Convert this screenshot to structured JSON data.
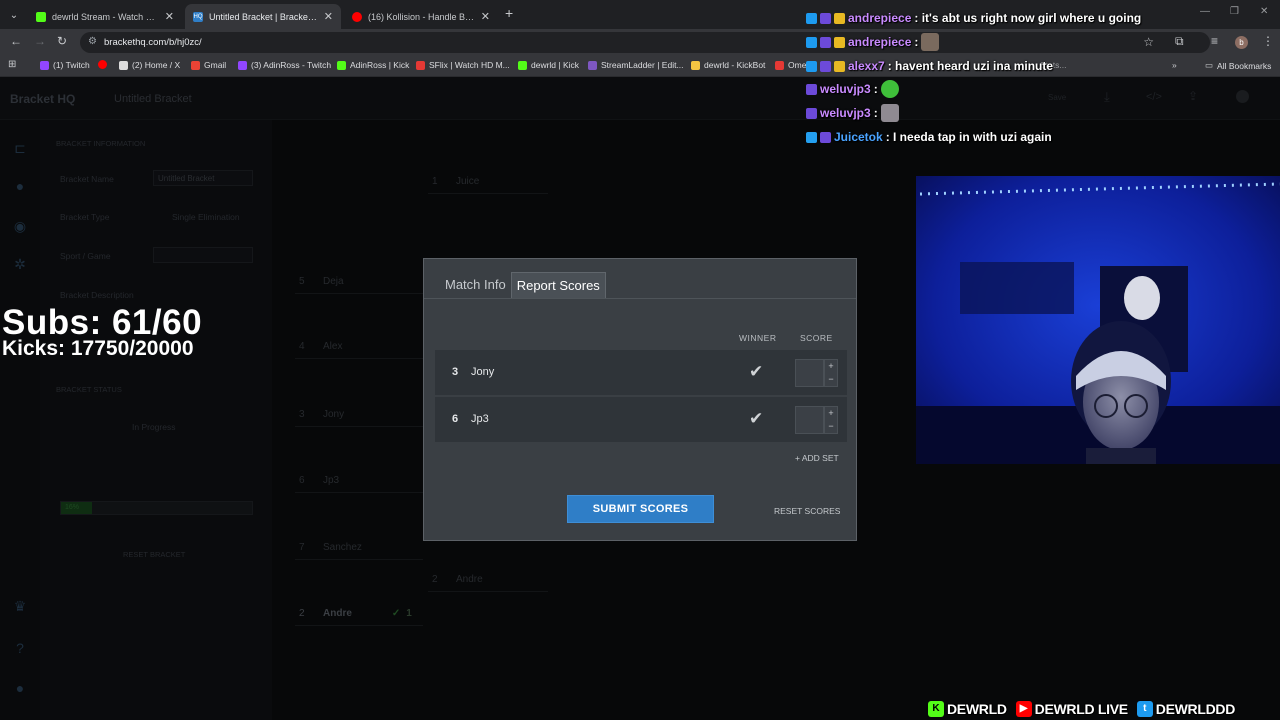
{
  "browser": {
    "tabs": [
      {
        "title": "dewrld Stream - Watch Live on Kick",
        "favicon_color": "#53fc18"
      },
      {
        "title": "Untitled Bracket | Bracket HQ",
        "favicon_color": "#2f7ec7",
        "active": true
      },
      {
        "title": "(16) Kollision - Handle Business",
        "favicon_color": "#ff0000"
      }
    ],
    "url": "brackethq.com/b/hj0zc/",
    "bookmarks": [
      {
        "label": "(1) Twitch",
        "color": "#9146ff"
      },
      {
        "label": "",
        "color": "#ff0000"
      },
      {
        "label": "(2) Home / X",
        "color": "#dddddd"
      },
      {
        "label": "Gmail",
        "color": "#ea4335"
      },
      {
        "label": "(3) AdinRoss - Twitch",
        "color": "#9146ff"
      },
      {
        "label": "AdinRoss | Kick",
        "color": "#53fc18"
      },
      {
        "label": "SFlix | Watch HD M...",
        "color": "#e53935"
      },
      {
        "label": "dewrld | Kick",
        "color": "#53fc18"
      },
      {
        "label": "StreamLadder | Edit...",
        "color": "#7e57c2"
      },
      {
        "label": "dewrld - KickBot",
        "color": "#f5c542"
      },
      {
        "label": "Ome",
        "color": "#e53935"
      }
    ],
    "bookmarks_overflow": "Stats...",
    "all_bookmarks": "All Bookmarks"
  },
  "bracket_page": {
    "brand": "Bracket HQ",
    "title": "Untitled Bracket",
    "save_label": "Save",
    "side_panel": {
      "section_info": "BRACKET INFORMATION",
      "name_label": "Bracket Name",
      "name_value": "Untitled Bracket",
      "type_label": "Bracket Type",
      "type_value": "Single Elimination",
      "sport_label": "Sport / Game",
      "description_label": "Bracket Description",
      "section_status": "BRACKET STATUS",
      "status_value": "In Progress",
      "progress_label": "16%",
      "progress_fraction": 0.16,
      "reset_label": "RESET BRACKET"
    },
    "seeds": [
      {
        "seed": "1",
        "name": "Juice"
      },
      {
        "seed": "5",
        "name": "Deja"
      },
      {
        "seed": "4",
        "name": "Alex"
      },
      {
        "seed": "3",
        "name": "Jony"
      },
      {
        "seed": "6",
        "name": "Jp3"
      },
      {
        "seed": "7",
        "name": "Sanchez"
      },
      {
        "seed": "2",
        "name": "Andre"
      },
      {
        "seed": "2",
        "name": "Andre",
        "score": "1"
      }
    ]
  },
  "modal": {
    "tabs": [
      "Match Info",
      "Report Scores"
    ],
    "winner_header": "WINNER",
    "score_header": "SCORE",
    "rows": [
      {
        "seed": "3",
        "name": "Jony",
        "score": ""
      },
      {
        "seed": "6",
        "name": "Jp3",
        "score": ""
      }
    ],
    "add_set": "+ ADD SET",
    "submit": "SUBMIT SCORES",
    "reset": "RESET SCORES"
  },
  "overlay": {
    "subs": "Subs: 61/60",
    "kicks": "Kicks: 17750/20000",
    "chat": [
      {
        "user": "andrepiece",
        "user_color": "#c98bff",
        "message": ": it's abt us right now girl where u going"
      },
      {
        "user": "andrepiece",
        "user_color": "#c98bff",
        "message": " :"
      },
      {
        "user": "alexx7",
        "user_color": "#c98bff",
        "message": ": havent heard uzi ina minute"
      },
      {
        "user": "weluvjp3",
        "user_color": "#c98bff",
        "message": " :"
      },
      {
        "user": "weluvjp3",
        "user_color": "#c98bff",
        "message": " :"
      },
      {
        "user": "Juicetok",
        "user_color": "#4aa3ff",
        "message": ": I needa tap in with uzi again"
      }
    ],
    "socials": [
      {
        "label": "DEWRLD",
        "icon": "kick-icon",
        "color": "#53fc18",
        "glyph": "K"
      },
      {
        "label": "DEWRLD LIVE",
        "icon": "youtube-icon",
        "color": "#ff0000",
        "glyph": "▶"
      },
      {
        "label": "DEWRLDDD",
        "icon": "twitter-icon",
        "color": "#1d9bf0",
        "glyph": "🐦"
      }
    ]
  }
}
